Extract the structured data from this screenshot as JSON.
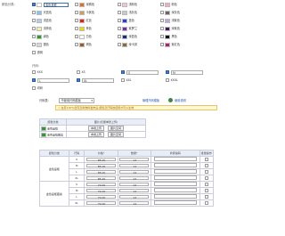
{
  "color_section": {
    "label": "颜色分类:",
    "colors": [
      {
        "label": "金色呈框",
        "checked": true,
        "swatch": "#ffffff",
        "custom": true
      },
      {
        "label": "深橘色",
        "checked": false,
        "swatch": "#e07020"
      },
      {
        "label": "浅粉色",
        "checked": false,
        "swatch": "#f4c2d0"
      },
      {
        "label": "粉色",
        "checked": false,
        "swatch": "#f5a8c6"
      },
      {
        "label": "天蓝色",
        "checked": false,
        "swatch": "#86c3ee"
      },
      {
        "label": "卡其色",
        "checked": false,
        "swatch": "#c8a064"
      },
      {
        "label": "浅灰色",
        "checked": false,
        "swatch": "#c8c8c8"
      },
      {
        "label": "深灰色",
        "checked": false,
        "swatch": "#666666"
      },
      {
        "label": "浅蓝色",
        "checked": false,
        "swatch": "#a8d0f2"
      },
      {
        "label": "红色",
        "checked": false,
        "swatch": "#e02020"
      },
      {
        "label": "蓝色",
        "checked": false,
        "swatch": "#2040d8"
      },
      {
        "label": "浅紫色",
        "checked": false,
        "swatch": "#c8a0e8"
      },
      {
        "label": "浅黄色",
        "checked": false,
        "swatch": "#f4ef9a"
      },
      {
        "label": "黄色",
        "checked": false,
        "swatch": "#f2d800"
      },
      {
        "label": "紫罗兰",
        "checked": false,
        "swatch": "#7a2aa8"
      },
      {
        "label": "深紫色",
        "checked": false,
        "swatch": "#4a1070"
      },
      {
        "label": "绿色",
        "checked": false,
        "swatch": "#28a028"
      },
      {
        "label": "白色",
        "checked": false,
        "swatch": "#ffffff"
      },
      {
        "label": "深蓝色",
        "checked": false,
        "swatch": "#1a2a80"
      },
      {
        "label": "黑色",
        "checked": false,
        "swatch": "#111111"
      },
      {
        "label": "银色",
        "checked": false,
        "swatch": "#d8d8d8"
      },
      {
        "label": "褐色",
        "checked": false,
        "swatch": "#a05a2a"
      },
      {
        "label": "深卡其",
        "checked": false,
        "swatch": "#8a6a3a"
      },
      {
        "label": "紫红色",
        "checked": false,
        "swatch": "#b02070"
      }
    ],
    "custom_label": "金色呈框",
    "extra_label": "透明"
  },
  "size_section": {
    "label": "尺码:",
    "rows": [
      [
        {
          "label": "XXS",
          "checked": false
        },
        {
          "label": "XS",
          "checked": false
        },
        {
          "label": "S",
          "checked": true,
          "value": "S"
        },
        {
          "label": "M",
          "checked": true,
          "value": "M"
        }
      ],
      [
        {
          "label": "L",
          "checked": true,
          "value": "L"
        },
        {
          "label": "XL",
          "checked": true,
          "value": "XL"
        },
        {
          "label": "XXL",
          "checked": false
        },
        {
          "label": "XXXL",
          "checked": false
        }
      ]
    ],
    "extra": "均码",
    "table_label": "尺码表:",
    "table_select": "不使用尺码模板",
    "manage_link": "管理尺码模板",
    "help_link": "使用说明"
  },
  "notice": "在有100%合同及新物料发布后,颜色及尺码的使用才可以生效",
  "image_section": {
    "col1": "颜色分类",
    "col2": "图片(仅能单张上传)",
    "rows": [
      {
        "color": "金色呈框",
        "upload": "本地上传",
        "space": "图片空间"
      },
      {
        "color": "金色呈框图案",
        "upload": "本地上传",
        "space": "图片空间"
      }
    ]
  },
  "sku_table": {
    "headers": [
      "颜色分类",
      "尺码",
      "价格*",
      "数量*",
      "商家编码",
      "批量操作"
    ],
    "groups": [
      {
        "color": "金色呈框",
        "rows": [
          {
            "size": "S",
            "price": "85.00",
            "qty": "13"
          },
          {
            "size": "M",
            "price": "85.00",
            "qty": "14"
          },
          {
            "size": "L",
            "price": "85.00",
            "qty": "14"
          },
          {
            "size": "XL",
            "price": "85.00",
            "qty": "14"
          }
        ]
      },
      {
        "color": "金色呈框图案",
        "rows": [
          {
            "size": "S",
            "price": "79.00",
            "qty": "14"
          },
          {
            "size": "M",
            "price": "79.00",
            "qty": "14"
          },
          {
            "size": "L",
            "price": "79.00",
            "qty": "14"
          },
          {
            "size": "XL",
            "price": "79.00",
            "qty": "14"
          }
        ]
      }
    ]
  }
}
